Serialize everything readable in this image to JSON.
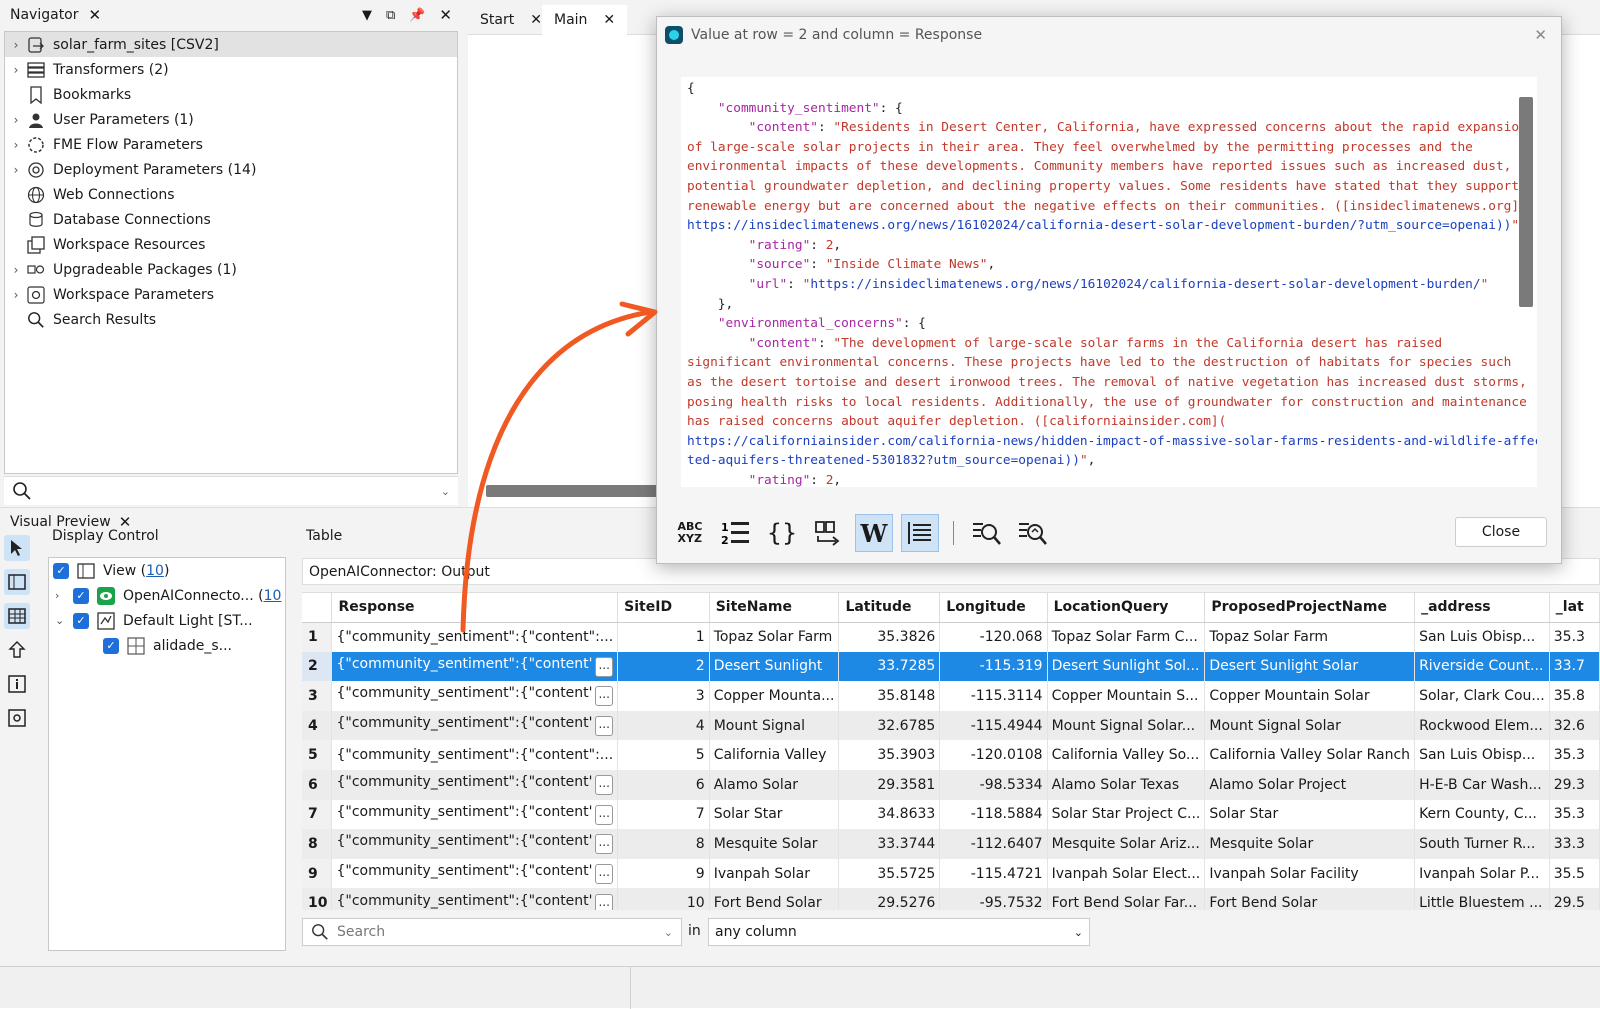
{
  "navigator": {
    "title": "Navigator",
    "items": [
      {
        "label": "solar_farm_sites [CSV2]",
        "icon": "dataset-icon",
        "expandable": true
      },
      {
        "label": "Transformers (2)",
        "icon": "stack-icon",
        "expandable": true
      },
      {
        "label": "Bookmarks",
        "icon": "bookmark-icon",
        "expandable": false
      },
      {
        "label": "User Parameters (1)",
        "icon": "user-params-icon",
        "expandable": true
      },
      {
        "label": "FME Flow Parameters",
        "icon": "flow-params-icon",
        "expandable": true
      },
      {
        "label": "Deployment Parameters (14)",
        "icon": "deployment-params-icon",
        "expandable": true
      },
      {
        "label": "Web Connections",
        "icon": "globe-icon",
        "expandable": false
      },
      {
        "label": "Database Connections",
        "icon": "database-icon",
        "expandable": false
      },
      {
        "label": "Workspace Resources",
        "icon": "resources-icon",
        "expandable": false
      },
      {
        "label": "Upgradeable Packages (1)",
        "icon": "packages-icon",
        "expandable": true
      },
      {
        "label": "Workspace Parameters",
        "icon": "workspace-params-icon",
        "expandable": true
      },
      {
        "label": "Search Results",
        "icon": "search-icon",
        "expandable": false
      }
    ]
  },
  "tabs": {
    "start": "Start",
    "main": "Main"
  },
  "visual_preview": {
    "title": "Visual Preview",
    "display_control": "Display Control",
    "table_label": "Table",
    "view_label": "View (",
    "view_count": "10",
    "view_close": ")",
    "layer1_label": "OpenAIConnecto... (",
    "layer1_count": "10",
    "layer2_label": "Default Light [ST...",
    "layer3_label": "alidade_s...",
    "source": "OpenAIConnector: Output"
  },
  "table": {
    "columns": [
      "",
      "Response",
      "SiteID",
      "SiteName",
      "Latitude",
      "Longitude",
      "LocationQuery",
      "ProposedProjectName",
      "_address",
      "_lat"
    ],
    "rows": [
      {
        "n": "1",
        "resp": "{\"community_sentiment\":{\"content\":...",
        "id": "1",
        "name": "Topaz Solar Farm",
        "lat": "35.3826",
        "lon": "-120.068",
        "lq": "Topaz Solar Farm C...",
        "ppn": "Topaz Solar Farm",
        "addr": "San Luis Obisp...",
        "l2": "35.3"
      },
      {
        "n": "2",
        "resp": "{\"community_sentiment\":{\"content'",
        "id": "2",
        "name": "Desert Sunlight",
        "lat": "33.7285",
        "lon": "-115.319",
        "lq": "Desert Sunlight Sol...",
        "ppn": "Desert Sunlight Solar",
        "addr": "Riverside Count...",
        "l2": "33.7"
      },
      {
        "n": "3",
        "resp": "{\"community_sentiment\":{\"content'",
        "id": "3",
        "name": "Copper Mounta...",
        "lat": "35.8148",
        "lon": "-115.3114",
        "lq": "Copper Mountain S...",
        "ppn": "Copper Mountain Solar",
        "addr": "Solar, Clark Cou...",
        "l2": "35.8"
      },
      {
        "n": "4",
        "resp": "{\"community_sentiment\":{\"content'",
        "id": "4",
        "name": "Mount Signal",
        "lat": "32.6785",
        "lon": "-115.4944",
        "lq": "Mount Signal Solar...",
        "ppn": "Mount Signal Solar",
        "addr": "Rockwood Elem...",
        "l2": "32.6"
      },
      {
        "n": "5",
        "resp": "{\"community_sentiment\":{\"content\":...",
        "id": "5",
        "name": "California Valley",
        "lat": "35.3903",
        "lon": "-120.0108",
        "lq": "California Valley So...",
        "ppn": "California Valley Solar Ranch",
        "addr": "San Luis Obisp...",
        "l2": "35.3"
      },
      {
        "n": "6",
        "resp": "{\"community_sentiment\":{\"content'",
        "id": "6",
        "name": "Alamo Solar",
        "lat": "29.3581",
        "lon": "-98.5334",
        "lq": "Alamo Solar Texas",
        "ppn": "Alamo Solar Project",
        "addr": "H-E-B Car Wash...",
        "l2": "29.3"
      },
      {
        "n": "7",
        "resp": "{\"community_sentiment\":{\"content'",
        "id": "7",
        "name": "Solar Star",
        "lat": "34.8633",
        "lon": "-118.5884",
        "lq": "Solar Star Project C...",
        "ppn": "Solar Star",
        "addr": "Kern County, C...",
        "l2": "35.3"
      },
      {
        "n": "8",
        "resp": "{\"community_sentiment\":{\"content'",
        "id": "8",
        "name": "Mesquite Solar",
        "lat": "33.3744",
        "lon": "-112.6407",
        "lq": "Mesquite Solar Ariz...",
        "ppn": "Mesquite Solar",
        "addr": "South Turner R...",
        "l2": "33.3"
      },
      {
        "n": "9",
        "resp": "{\"community_sentiment\":{\"content'",
        "id": "9",
        "name": "Ivanpah Solar",
        "lat": "35.5725",
        "lon": "-115.4721",
        "lq": "Ivanpah Solar Elect...",
        "ppn": "Ivanpah Solar Facility",
        "addr": "Ivanpah Solar P...",
        "l2": "35.5"
      },
      {
        "n": "10",
        "resp": "{\"community_sentiment\":{\"content'",
        "id": "10",
        "name": "Fort Bend Solar",
        "lat": "29.5276",
        "lon": "-95.7532",
        "lq": "Fort Bend Solar Far...",
        "ppn": "Fort Bend Solar",
        "addr": "Little Bluestem ...",
        "l2": "29.5"
      }
    ],
    "ellipsis": "...",
    "search_placeholder": "Search",
    "in_label": "in",
    "column_select": "any column"
  },
  "dialog": {
    "title": "Value at row = 2 and column = Response",
    "close_label": "Close",
    "lines": [
      [
        [
          "p",
          "{"
        ]
      ],
      [
        [
          "p",
          "    "
        ],
        [
          "k",
          "\"community_sentiment\""
        ],
        [
          "p",
          ": {"
        ]
      ],
      [
        [
          "p",
          "        "
        ],
        [
          "k",
          "\"content\""
        ],
        [
          "p",
          ": "
        ],
        [
          "s",
          "\"Residents in Desert Center, California, have expressed concerns about the rapid expansion"
        ]
      ],
      [
        [
          "s",
          "of large-scale solar projects in their area. They feel overwhelmed by the permitting processes and the"
        ]
      ],
      [
        [
          "s",
          "environmental impacts of these developments. Community members have reported issues such as increased dust,"
        ]
      ],
      [
        [
          "s",
          "potential groundwater depletion, and declining property values. Some residents have stated that they support"
        ]
      ],
      [
        [
          "s",
          "renewable energy but are concerned about the negative effects on their communities. ([insideclimatenews.org]("
        ]
      ],
      [
        [
          "u",
          "https://insideclimatenews.org/news/16102024/california-desert-solar-development-burden/?utm_source=openai))"
        ],
        [
          "s",
          "\""
        ],
        [
          "p",
          ","
        ]
      ],
      [
        [
          "p",
          "        "
        ],
        [
          "k",
          "\"rating\""
        ],
        [
          "p",
          ": "
        ],
        [
          "s",
          "2"
        ],
        [
          "p",
          ","
        ]
      ],
      [
        [
          "p",
          "        "
        ],
        [
          "k",
          "\"source\""
        ],
        [
          "p",
          ": "
        ],
        [
          "s",
          "\"Inside Climate News\""
        ],
        [
          "p",
          ","
        ]
      ],
      [
        [
          "p",
          "        "
        ],
        [
          "k",
          "\"url\""
        ],
        [
          "p",
          ": "
        ],
        [
          "s",
          "\""
        ],
        [
          "u",
          "https://insideclimatenews.org/news/16102024/california-desert-solar-development-burden/"
        ],
        [
          "s",
          "\""
        ]
      ],
      [
        [
          "p",
          "    },"
        ]
      ],
      [
        [
          "p",
          "    "
        ],
        [
          "k",
          "\"environmental_concerns\""
        ],
        [
          "p",
          ": {"
        ]
      ],
      [
        [
          "p",
          "        "
        ],
        [
          "k",
          "\"content\""
        ],
        [
          "p",
          ": "
        ],
        [
          "s",
          "\"The development of large-scale solar farms in the California desert has raised"
        ]
      ],
      [
        [
          "s",
          "significant environmental concerns. These projects have led to the destruction of habitats for species such"
        ]
      ],
      [
        [
          "s",
          "as the desert tortoise and desert ironwood trees. The removal of native vegetation has increased dust storms,"
        ]
      ],
      [
        [
          "s",
          "posing health risks to local residents. Additionally, the use of groundwater for construction and maintenance"
        ]
      ],
      [
        [
          "s",
          "has raised concerns about aquifer depletion. ([californiainsider.com]("
        ]
      ],
      [
        [
          "u",
          "https://californiainsider.com/california-news/hidden-impact-of-massive-solar-farms-residents-and-wildlife-affec"
        ]
      ],
      [
        [
          "u",
          "ted-aquifers-threatened-5301832?utm_source=openai))"
        ],
        [
          "s",
          "\""
        ],
        [
          "p",
          ","
        ]
      ],
      [
        [
          "p",
          "        "
        ],
        [
          "k",
          "\"rating\""
        ],
        [
          "p",
          ": "
        ],
        [
          "s",
          "2"
        ],
        [
          "p",
          ","
        ]
      ]
    ]
  },
  "colors": {
    "accent": "#1e88e5",
    "arrow": "#f05a22",
    "selection_row": "#1e88e5"
  }
}
